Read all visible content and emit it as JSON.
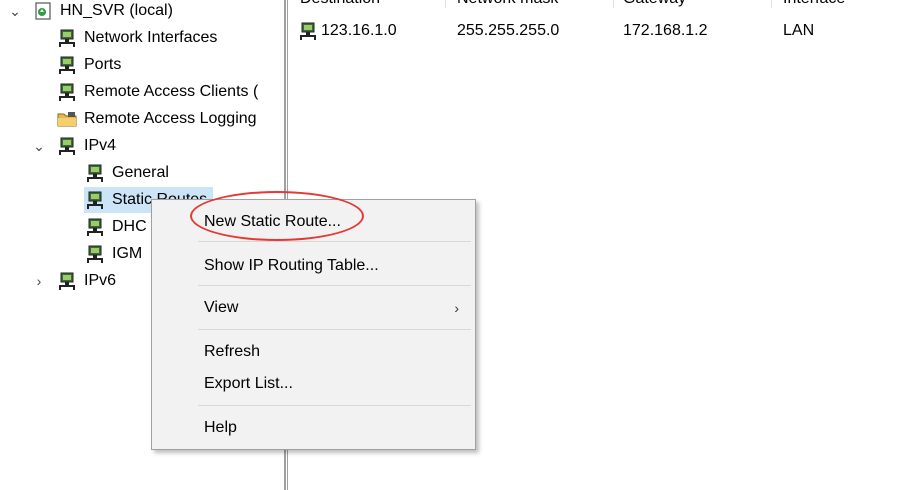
{
  "tree": {
    "items": [
      {
        "label": "HN_SVR (local)",
        "icon": "server-icon",
        "expander": "chevron-down"
      },
      {
        "label": "Network Interfaces",
        "icon": "network-icon"
      },
      {
        "label": "Ports",
        "icon": "network-icon"
      },
      {
        "label": "Remote Access Clients (",
        "icon": "network-icon"
      },
      {
        "label": "Remote Access Logging",
        "icon": "folder-icon"
      },
      {
        "label": "IPv4",
        "icon": "network-icon",
        "expander": "chevron-down"
      },
      {
        "label": "General",
        "icon": "network-icon"
      },
      {
        "label": "Static Routes",
        "icon": "network-icon",
        "selected": true
      },
      {
        "label": "DHC",
        "icon": "network-icon"
      },
      {
        "label": "IGM",
        "icon": "network-icon"
      },
      {
        "label": "IPv6",
        "icon": "network-icon",
        "expander": "chevron-right"
      }
    ]
  },
  "list": {
    "columns": [
      "Destination",
      "Network mask",
      "Gateway",
      "Interface"
    ],
    "rows": [
      {
        "destination": "123.16.1.0",
        "mask": "255.255.255.0",
        "gateway": "172.168.1.2",
        "interface": "LAN"
      }
    ]
  },
  "context_menu": {
    "items": [
      {
        "label": "New Static Route...",
        "highlighted_callout": true
      },
      {
        "label": "Show IP Routing Table..."
      },
      {
        "label": "View",
        "submenu": true,
        "arrow": "›"
      },
      {
        "label": "Refresh"
      },
      {
        "label": "Export List..."
      },
      {
        "label": "Help"
      }
    ]
  },
  "colors": {
    "callout": "#e53935",
    "selection": "#cce4f7",
    "menu_bg": "#f2f2f2"
  }
}
